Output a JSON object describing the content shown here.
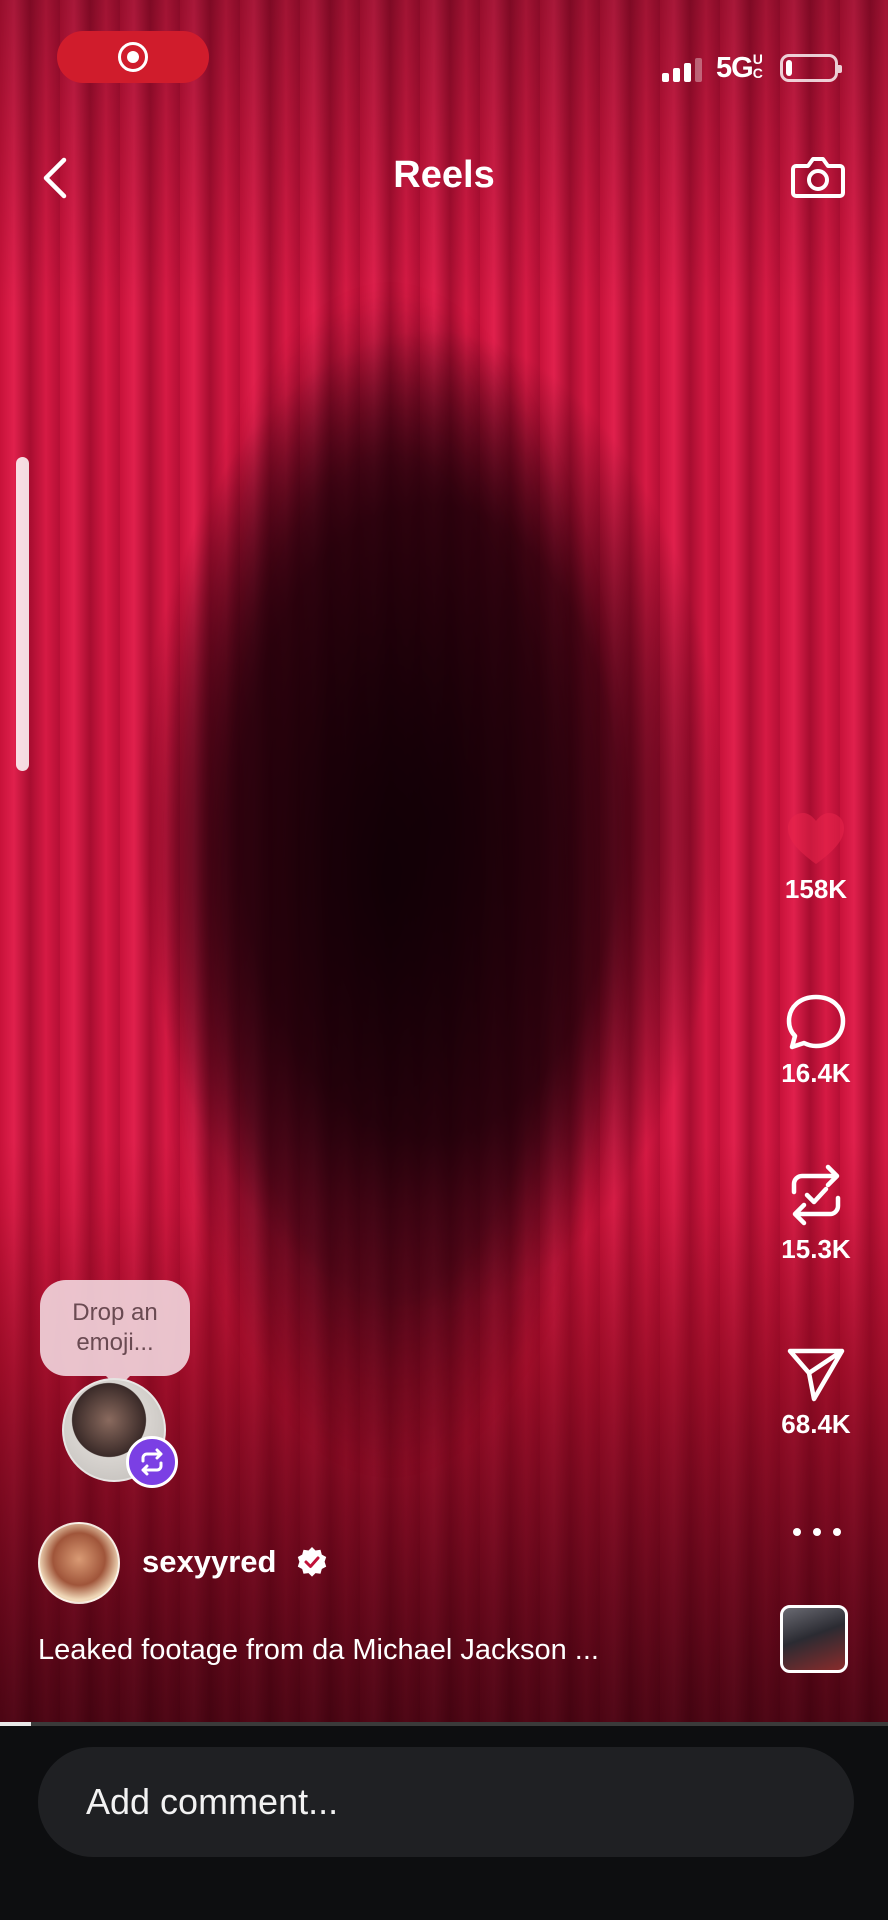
{
  "status_bar": {
    "network": "5G",
    "network_suffix": "UC",
    "battery_level": 0.12,
    "signal_bars": 3
  },
  "header": {
    "title": "Reels"
  },
  "friend_activity": {
    "prompt": "Drop an emoji..."
  },
  "actions": {
    "likes": "158K",
    "comments": "16.4K",
    "reposts": "15.3K",
    "shares": "68.4K"
  },
  "author": {
    "username": "sexyyred",
    "verified": true
  },
  "caption": "Leaked footage from da Michael Jackson ...",
  "playback": {
    "progress": 0.035
  },
  "comment_bar": {
    "placeholder": "Add comment..."
  },
  "colors": {
    "record_pill": "#d01c2c",
    "repost_badge": "#7b3fe4",
    "video_tint": "#c01238",
    "comment_bar_bg": "#0d0e10"
  },
  "icons": {
    "back": "chevron-left-icon",
    "camera": "camera-icon",
    "like": "heart-icon",
    "comment": "comment-bubble-icon",
    "repost": "repost-icon",
    "share": "paper-plane-icon",
    "more": "more-dots-icon",
    "verified": "verified-badge-icon"
  }
}
